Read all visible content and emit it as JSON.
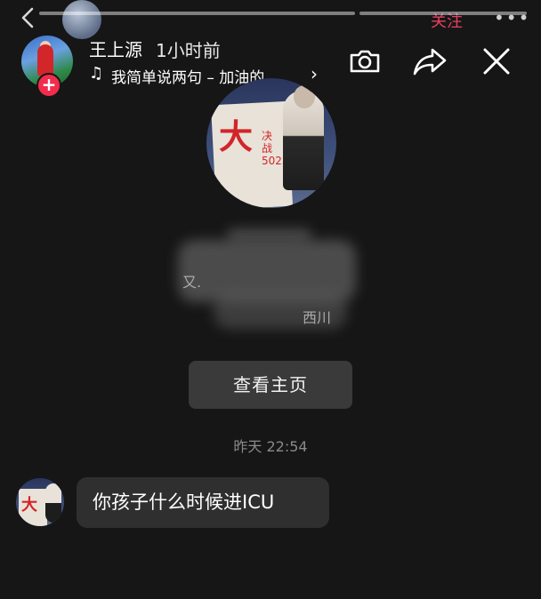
{
  "background_header": {
    "back_icon": "chevron-left-icon",
    "follow_label": "关注",
    "more_label": "•••"
  },
  "story": {
    "progress": [
      1.0,
      0.0
    ],
    "username": "王上源",
    "time": "1小时前",
    "music_icon": "♫",
    "music_text": "我简单说两句 – 加油的…",
    "music_chevron": "›",
    "actions": [
      "camera-icon",
      "share-icon",
      "close-icon"
    ]
  },
  "shared_card": {
    "poster_big_char": "大",
    "poster_vertical_text": "决战5025",
    "blurred_text_1": "又.",
    "blurred_text_2": "西川",
    "view_button_label": "查看主页"
  },
  "conversation": {
    "timestamp": "昨天 22:54",
    "messages": [
      {
        "sender": "incoming",
        "text": "你孩子什么时候进ICU"
      }
    ]
  },
  "colors": {
    "background": "#161616",
    "accent_red": "#f12c4d",
    "follow_red": "#e5405f",
    "bubble": "#2f2f2f",
    "button": "#3a3a3a"
  }
}
